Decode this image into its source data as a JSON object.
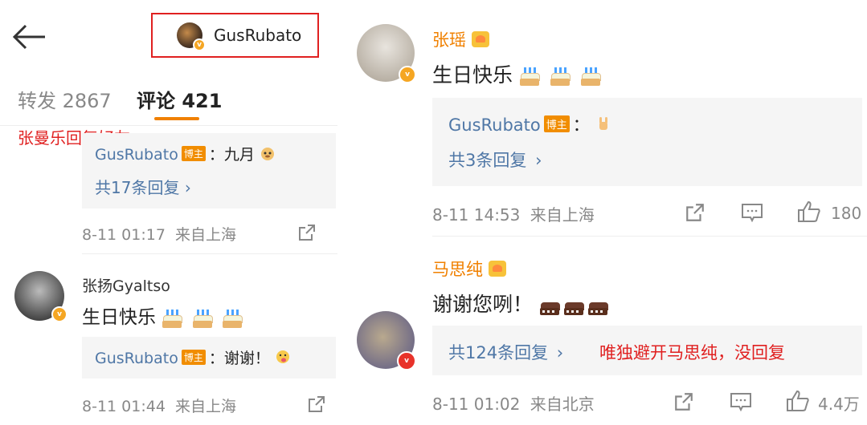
{
  "header": {
    "username": "GusRubato"
  },
  "tabs": {
    "repost": "转发 2867",
    "comments": "评论 421"
  },
  "annotations": {
    "left": "张曼乐回复好友",
    "right": "唯独避开马思纯，没回复"
  },
  "left_comments": [
    {
      "reply": {
        "author": "GusRubato",
        "badge": "博主",
        "text": "：九月"
      },
      "more": "共17条回复",
      "time": "8-11 01:17",
      "location": "来自上海"
    },
    {
      "author": "张扬Gyaltso",
      "text": "生日快乐",
      "reply": {
        "author": "GusRubato",
        "badge": "博主",
        "text": "：谢谢！"
      },
      "time": "8-11 01:44",
      "location": "来自上海"
    }
  ],
  "right_comments": [
    {
      "author": "张瑶",
      "text": "生日快乐",
      "reply": {
        "author": "GusRubato",
        "badge": "博主",
        "text": "："
      },
      "more": "共3条回复",
      "time": "8-11 14:53",
      "location": "来自上海",
      "likes": "180"
    },
    {
      "author": "马思纯",
      "text": "谢谢您咧！",
      "more": "共124条回复",
      "time": "8-11 01:02",
      "location": "来自北京",
      "likes": "4.4万"
    }
  ],
  "colors": {
    "accent": "#f08000",
    "link": "#4f77a6",
    "annotation": "#e02020",
    "badge": "#f18d00"
  }
}
